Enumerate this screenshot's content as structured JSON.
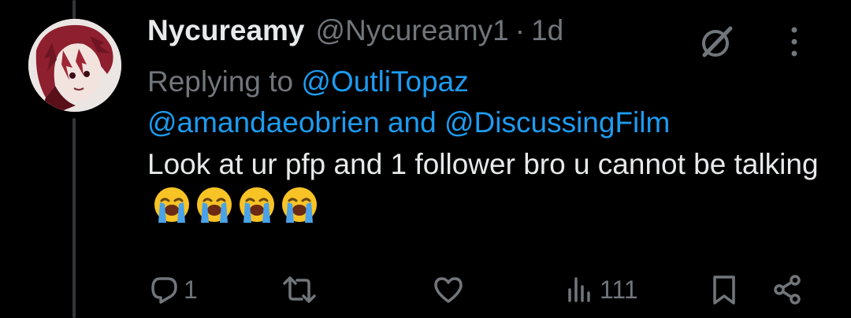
{
  "tweet": {
    "display_name": "Nycureamy",
    "handle": "@Nycureamy1",
    "separator": "·",
    "time": "1d",
    "replying_prefix": "Replying to",
    "mention_1": "@OutliTopaz",
    "mention_2": "@amandaeobrien",
    "conjunction": "and",
    "mention_3": "@DiscussingFilm",
    "text": "Look at ur pfp and 1 follower bro u cannot be talking",
    "emojis": [
      "loudly-crying-face",
      "loudly-crying-face",
      "loudly-crying-face",
      "loudly-crying-face"
    ]
  },
  "actions": {
    "reply_count": "1",
    "repost_count": "",
    "like_count": "",
    "views_count": "111"
  },
  "icons": {
    "grok": "grok-icon",
    "more": "more-vertical-icon",
    "reply": "reply-icon",
    "repost": "repost-icon",
    "like": "heart-icon",
    "views": "views-icon",
    "bookmark": "bookmark-icon",
    "share": "share-icon"
  },
  "colors": {
    "background": "#000000",
    "text": "#e7e9ea",
    "muted": "#71767b",
    "link": "#1d9bf0"
  }
}
